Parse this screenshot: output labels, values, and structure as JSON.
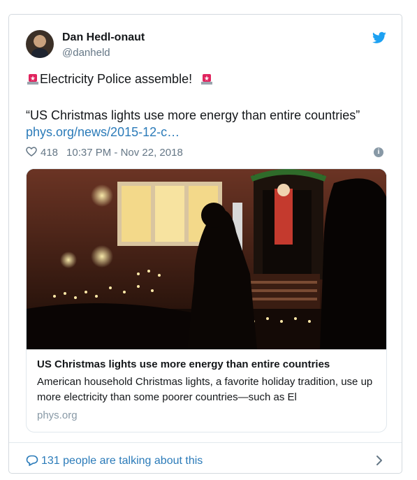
{
  "tweet": {
    "author_name": "Dan Hedl-onaut",
    "author_handle": "@danheld",
    "line1": "Electricity Police assemble!",
    "line2": "“US Christmas lights use more energy than entire countries”",
    "link_text": "phys.org/news/2015-12-c…",
    "likes": "418",
    "timestamp": "10:37 PM - Nov 22, 2018",
    "info_symbol": "i"
  },
  "preview": {
    "title": "US Christmas lights use more energy than entire countries",
    "description": "American household Christmas lights, a favorite holiday tradition, use up more electricity than some poorer countries—such as El",
    "domain": "phys.org"
  },
  "footer": {
    "talking": "131 people are talking about this"
  },
  "colors": {
    "link": "#2b7bb9",
    "twitter_blue": "#1da1f2",
    "muted": "#657786",
    "siren": "#e0245e"
  }
}
